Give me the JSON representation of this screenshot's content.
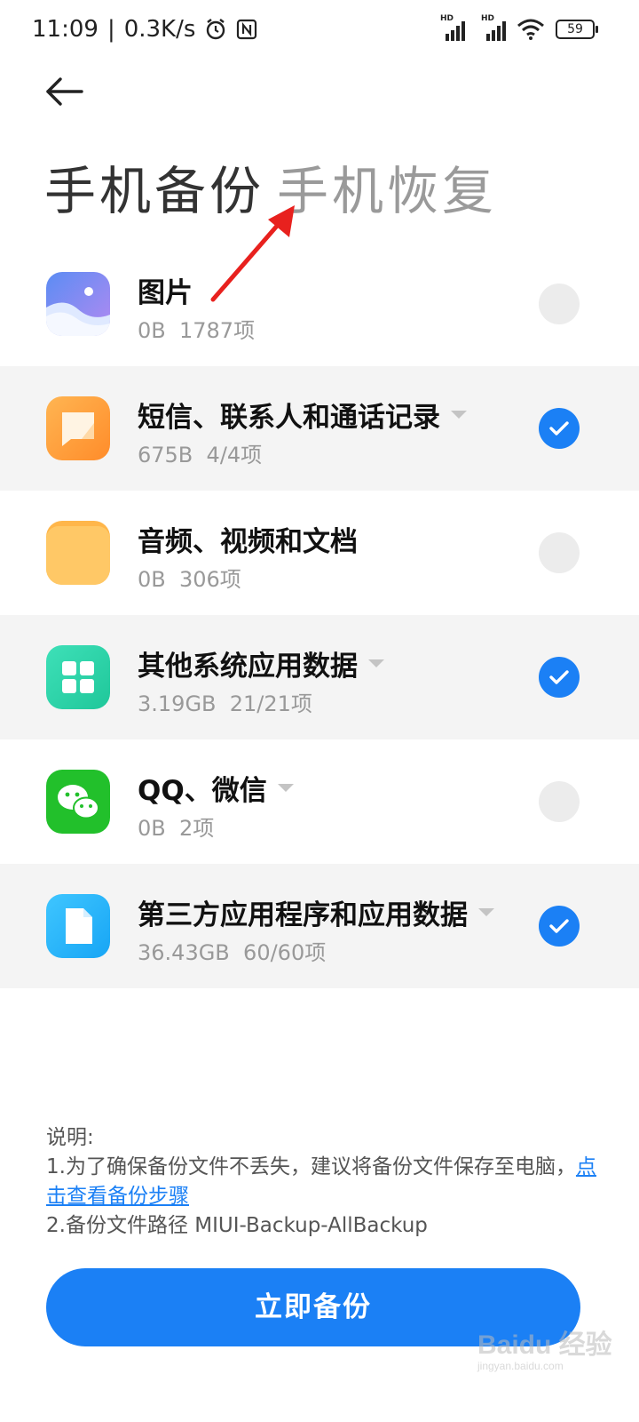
{
  "status_bar": {
    "time": "11:09",
    "network_speed": "0.3K/s",
    "battery": "59"
  },
  "tabs": {
    "backup": "手机备份",
    "restore": "手机恢复"
  },
  "items": [
    {
      "title": "图片",
      "size": "0B",
      "count": "1787项",
      "checked": false,
      "icon": "photo-icon",
      "has_dropdown": false
    },
    {
      "title": "短信、联系人和通话记录",
      "size": "675B",
      "count": "4/4项",
      "checked": true,
      "icon": "message-icon",
      "has_dropdown": true
    },
    {
      "title": "音频、视频和文档",
      "size": "0B",
      "count": "306项",
      "checked": false,
      "icon": "folder-icon",
      "has_dropdown": false
    },
    {
      "title": "其他系统应用数据",
      "size": "3.19GB",
      "count": "21/21项",
      "checked": true,
      "icon": "apps-grid-icon",
      "has_dropdown": true
    },
    {
      "title": "QQ、微信",
      "size": "0B",
      "count": "2项",
      "checked": false,
      "icon": "wechat-icon",
      "has_dropdown": true
    },
    {
      "title": "第三方应用程序和应用数据",
      "size": "36.43GB",
      "count": "60/60项",
      "checked": true,
      "icon": "document-icon",
      "has_dropdown": true
    }
  ],
  "note": {
    "heading": "说明:",
    "line1": "1.为了确保备份文件不丢失，建议将备份文件保存至电脑，",
    "link": "点击查看备份步骤",
    "line2": "2.备份文件路径 MIUI-Backup-AllBackup"
  },
  "backup_button": "立即备份",
  "watermark": {
    "text": "Baidu 经验",
    "url": "jingyan.baidu.com"
  },
  "colors": {
    "accent": "#1b80f5",
    "annotation_arrow": "#e8211e",
    "row_shade": "#f4f4f4"
  }
}
